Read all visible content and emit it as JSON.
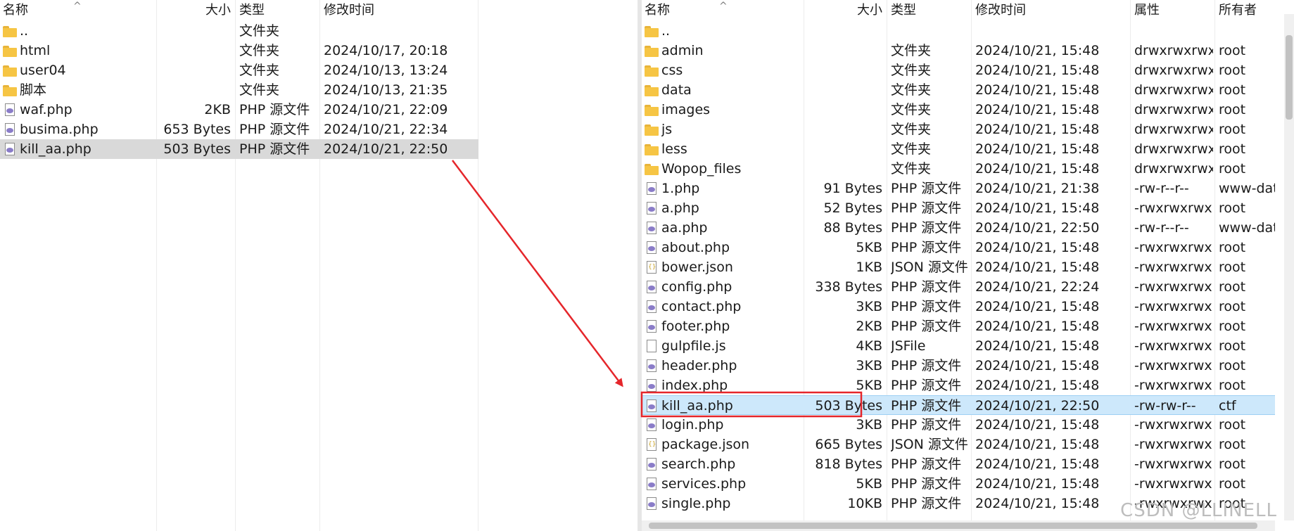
{
  "left": {
    "columns": {
      "name": "名称",
      "size": "大小",
      "type": "类型",
      "modified": "修改时间"
    },
    "rows": [
      {
        "icon": "folder-icon",
        "name": "..",
        "size": "",
        "type": "文件夹",
        "modified": ""
      },
      {
        "icon": "folder-icon",
        "name": "html",
        "size": "",
        "type": "文件夹",
        "modified": "2024/10/17, 20:18"
      },
      {
        "icon": "folder-icon",
        "name": "user04",
        "size": "",
        "type": "文件夹",
        "modified": "2024/10/13, 13:24"
      },
      {
        "icon": "folder-icon",
        "name": "脚本",
        "size": "",
        "type": "文件夹",
        "modified": "2024/10/13, 21:35"
      },
      {
        "icon": "php-file-icon",
        "name": "waf.php",
        "size": "2KB",
        "type": "PHP 源文件",
        "modified": "2024/10/21, 22:09"
      },
      {
        "icon": "php-file-icon",
        "name": "busima.php",
        "size": "653 Bytes",
        "type": "PHP 源文件",
        "modified": "2024/10/21, 22:34"
      },
      {
        "icon": "php-file-icon",
        "name": "kill_aa.php",
        "size": "503 Bytes",
        "type": "PHP 源文件",
        "modified": "2024/10/21, 22:50",
        "selected": true
      }
    ]
  },
  "right": {
    "columns": {
      "name": "名称",
      "size": "大小",
      "type": "类型",
      "modified": "修改时间",
      "perms": "属性",
      "owner": "所有者"
    },
    "rows": [
      {
        "icon": "folder-icon",
        "name": "..",
        "size": "",
        "type": "",
        "modified": "",
        "perms": "",
        "owner": ""
      },
      {
        "icon": "folder-icon",
        "name": "admin",
        "size": "",
        "type": "文件夹",
        "modified": "2024/10/21, 15:48",
        "perms": "drwxrwxrwx",
        "owner": "root"
      },
      {
        "icon": "folder-icon",
        "name": "css",
        "size": "",
        "type": "文件夹",
        "modified": "2024/10/21, 15:48",
        "perms": "drwxrwxrwx",
        "owner": "root"
      },
      {
        "icon": "folder-icon",
        "name": "data",
        "size": "",
        "type": "文件夹",
        "modified": "2024/10/21, 15:48",
        "perms": "drwxrwxrwx",
        "owner": "root"
      },
      {
        "icon": "folder-icon",
        "name": "images",
        "size": "",
        "type": "文件夹",
        "modified": "2024/10/21, 15:48",
        "perms": "drwxrwxrwx",
        "owner": "root"
      },
      {
        "icon": "folder-icon",
        "name": "js",
        "size": "",
        "type": "文件夹",
        "modified": "2024/10/21, 15:48",
        "perms": "drwxrwxrwx",
        "owner": "root"
      },
      {
        "icon": "folder-icon",
        "name": "less",
        "size": "",
        "type": "文件夹",
        "modified": "2024/10/21, 15:48",
        "perms": "drwxrwxrwx",
        "owner": "root"
      },
      {
        "icon": "folder-icon",
        "name": "Wopop_files",
        "size": "",
        "type": "文件夹",
        "modified": "2024/10/21, 15:48",
        "perms": "drwxrwxrwx",
        "owner": "root"
      },
      {
        "icon": "php-file-icon",
        "name": "1.php",
        "size": "91 Bytes",
        "type": "PHP 源文件",
        "modified": "2024/10/21, 21:38",
        "perms": "-rw-r--r--",
        "owner": "www-data"
      },
      {
        "icon": "php-file-icon",
        "name": "a.php",
        "size": "52 Bytes",
        "type": "PHP 源文件",
        "modified": "2024/10/21, 15:48",
        "perms": "-rwxrwxrwx",
        "owner": "root"
      },
      {
        "icon": "php-file-icon",
        "name": "aa.php",
        "size": "88 Bytes",
        "type": "PHP 源文件",
        "modified": "2024/10/21, 22:50",
        "perms": "-rw-r--r--",
        "owner": "www-data"
      },
      {
        "icon": "php-file-icon",
        "name": "about.php",
        "size": "5KB",
        "type": "PHP 源文件",
        "modified": "2024/10/21, 15:48",
        "perms": "-rwxrwxrwx",
        "owner": "root"
      },
      {
        "icon": "json-file-icon",
        "name": "bower.json",
        "size": "1KB",
        "type": "JSON 源文件",
        "modified": "2024/10/21, 15:48",
        "perms": "-rwxrwxrwx",
        "owner": "root"
      },
      {
        "icon": "php-file-icon",
        "name": "config.php",
        "size": "338 Bytes",
        "type": "PHP 源文件",
        "modified": "2024/10/21, 22:24",
        "perms": "-rwxrwxrwx",
        "owner": "root"
      },
      {
        "icon": "php-file-icon",
        "name": "contact.php",
        "size": "3KB",
        "type": "PHP 源文件",
        "modified": "2024/10/21, 15:48",
        "perms": "-rwxrwxrwx",
        "owner": "root"
      },
      {
        "icon": "php-file-icon",
        "name": "footer.php",
        "size": "2KB",
        "type": "PHP 源文件",
        "modified": "2024/10/21, 15:48",
        "perms": "-rwxrwxrwx",
        "owner": "root"
      },
      {
        "icon": "js-file-icon",
        "name": "gulpfile.js",
        "size": "4KB",
        "type": "JSFile",
        "modified": "2024/10/21, 15:48",
        "perms": "-rwxrwxrwx",
        "owner": "root"
      },
      {
        "icon": "php-file-icon",
        "name": "header.php",
        "size": "3KB",
        "type": "PHP 源文件",
        "modified": "2024/10/21, 15:48",
        "perms": "-rwxrwxrwx",
        "owner": "root"
      },
      {
        "icon": "php-file-icon",
        "name": "index.php",
        "size": "5KB",
        "type": "PHP 源文件",
        "modified": "2024/10/21, 15:48",
        "perms": "-rwxrwxrwx",
        "owner": "root"
      },
      {
        "icon": "php-file-icon",
        "name": "kill_aa.php",
        "size": "503 Bytes",
        "type": "PHP 源文件",
        "modified": "2024/10/21, 22:50",
        "perms": "-rw-rw-r--",
        "owner": "ctf",
        "selected": true
      },
      {
        "icon": "php-file-icon",
        "name": "login.php",
        "size": "3KB",
        "type": "PHP 源文件",
        "modified": "2024/10/21, 15:48",
        "perms": "-rwxrwxrwx",
        "owner": "root"
      },
      {
        "icon": "json-file-icon",
        "name": "package.json",
        "size": "665 Bytes",
        "type": "JSON 源文件",
        "modified": "2024/10/21, 15:48",
        "perms": "-rwxrwxrwx",
        "owner": "root"
      },
      {
        "icon": "php-file-icon",
        "name": "search.php",
        "size": "818 Bytes",
        "type": "PHP 源文件",
        "modified": "2024/10/21, 15:48",
        "perms": "-rwxrwxrwx",
        "owner": "root"
      },
      {
        "icon": "php-file-icon",
        "name": "services.php",
        "size": "5KB",
        "type": "PHP 源文件",
        "modified": "2024/10/21, 15:48",
        "perms": "-rwxrwxrwx",
        "owner": "root"
      },
      {
        "icon": "php-file-icon",
        "name": "single.php",
        "size": "10KB",
        "type": "PHP 源文件",
        "modified": "2024/10/21, 15:48",
        "perms": "-rwxrwxrwx",
        "owner": "root"
      }
    ]
  },
  "annotation": {
    "color": "#e5262b"
  },
  "watermark": "CSDN @LLINELL"
}
